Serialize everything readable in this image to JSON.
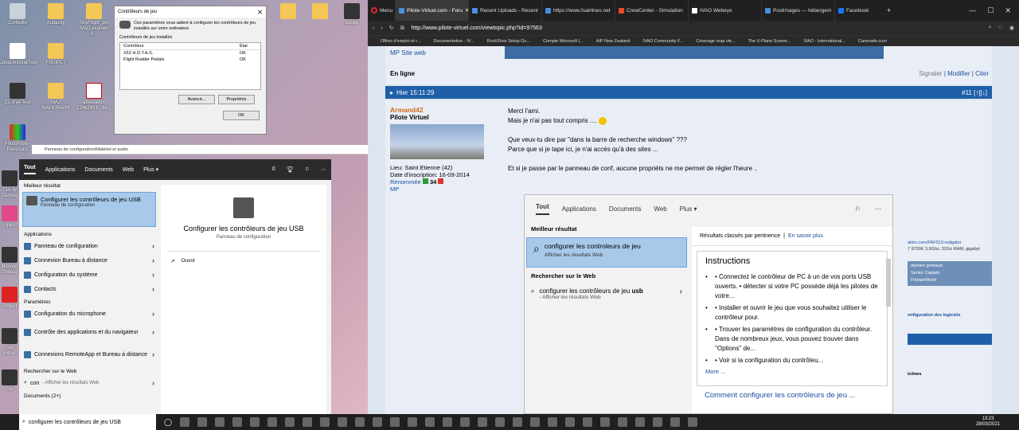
{
  "desktop": {
    "icons": [
      {
        "label": "Corbeille",
        "kind": "bin"
      },
      {
        "label": "Audacity",
        "kind": "folder"
      },
      {
        "label": "TinyFlight_pro IVAO examen S...",
        "kind": "folder"
      },
      {
        "label": "JavaUninstallTool",
        "kind": "java"
      },
      {
        "label": "FSUIPC7",
        "kind": "folder"
      },
      {
        "label": "CL-Eye Test",
        "kind": "dark"
      },
      {
        "label": "MAJ NAVIGRAPH",
        "kind": "folder"
      },
      {
        "label": "attestation 12462431 - de...",
        "kind": "pdf"
      },
      {
        "label": "PhotoFiltre - Raccourci",
        "kind": "photo"
      },
      {
        "label": "T16 W Gaming",
        "kind": "dark"
      },
      {
        "label": "open",
        "kind": "pink"
      },
      {
        "label": "Microso Simula",
        "kind": "dark"
      },
      {
        "label": "Project",
        "kind": "red"
      },
      {
        "label": "Gef Exper",
        "kind": "dark"
      },
      {
        "label": "Ste",
        "kind": "dark"
      }
    ],
    "top_right_icons": [
      {
        "label": "",
        "kind": "folder"
      },
      {
        "label": "",
        "kind": "folder"
      },
      {
        "label": "Loupe",
        "kind": "dark"
      }
    ]
  },
  "joy_dialog": {
    "title": "Contrôleurs de jeu",
    "intro": "Ces paramètres vous aident à configurer les contrôleurs de jeu installés sur votre ordinateur.",
    "group_label": "Contrôleurs de jeu installés",
    "col_controller": "Contrôleur",
    "col_state": "État",
    "rows": [
      {
        "name": "X52 H.O.T.A.S.",
        "state": "OK"
      },
      {
        "name": "Flight Rudder Pedals",
        "state": "OK"
      }
    ],
    "advanced_button": "Avancé...",
    "properties_button": "Propriétés",
    "ok_button": "OK"
  },
  "control_panel_title": "Panneau de configuration\\Matériel et audio",
  "start_search": {
    "tabs": [
      "Tout",
      "Applications",
      "Documents",
      "Web",
      "Plus ▾"
    ],
    "score": "0",
    "best_header": "Meilleur résultat",
    "best_title": "Configurer les contrôleurs de jeu USB",
    "best_sub": "Panneau de configuration",
    "apps_header": "Applications",
    "apps": [
      "Panneau de configuration",
      "Connexion Bureau à distance",
      "Configuration du système",
      "Contacts"
    ],
    "params_header": "Paramètres",
    "params": [
      "Configuration du microphone",
      "Contrôle des applications et du navigateur",
      "Connexions RemoteApp et Bureau à distance"
    ],
    "web_header": "Rechercher sur le Web",
    "web_query": "con",
    "web_sub": "- Afficher les résultats Web",
    "docs_header": "Documents (2+)",
    "right_title": "Configurer les contrôleurs de jeu USB",
    "right_sub": "Panneau de configuration",
    "open_label": "Ouvrir"
  },
  "taskbar": {
    "search_value": "configurer les contrôleurs de jeu USB",
    "time": "13:23",
    "date": "28/03/2021"
  },
  "browser": {
    "menu_label": "Menu",
    "tabs": [
      {
        "label": "Pilote-Virtuel.com - Foru",
        "active": true
      },
      {
        "label": "Recent Uploads - Recent",
        "active": false
      },
      {
        "label": "https://www.fsairlines.net",
        "active": false
      },
      {
        "label": "CrewCenter - Simulation",
        "active": false
      },
      {
        "label": "IVAO Webeye",
        "active": false
      },
      {
        "label": "Postimages — hébergem",
        "active": false
      },
      {
        "label": "Facebook",
        "active": false
      }
    ],
    "url": "http://www.pilote-virtuel.com/viewtopic.php?id=97563",
    "bookmarks": [
      "Offres d'emploi et r...",
      "Documentation - IV...",
      "RockShox Setup Gu...",
      "Compte Microsoft |...",
      "AIP New Zealand",
      "IVAO Community F...",
      "Coverage map vie...",
      "The X-Plane Scener...",
      "IVAO - International...",
      "Carenado.com"
    ]
  },
  "forum": {
    "prev_mp": "MP",
    "prev_site": "Site web",
    "online": "En ligne",
    "actions": [
      "Signaler",
      "Modifier",
      "Citer"
    ],
    "post_time": "Hier 15:11:29",
    "post_num": "#11 [↑][↓]",
    "author_name": "Armand42",
    "author_role": "Pilote Virtuel",
    "author_lieu": "Lieu: Saint Etienne (42)",
    "author_inscription": "Date d'inscription: 16-09-2014",
    "author_renommee_label": "Renommée",
    "author_renommee_value": "34",
    "author_mp": "MP",
    "msg_line1": "Merci l'ami.",
    "msg_line2": "Mais je n'ai pas tout compris ....",
    "msg_line3": "Que veux-tu dire par \"dans la barre de recherche windows\" ???",
    "msg_line4": "Parce que si je tape ici, je n'ai accès qu'à des sites ...",
    "msg_line5": "Et si je passe par le panneau de conf, aucune propriéts ne me permet de régler l'heure ..",
    "side_link": "ation.com/FAF013-ouligator",
    "side_specs": "7 9700K 3,6Ghz, 32Go RAM, gigabyt",
    "side_names": [
      "damien gerbaud",
      "Senior Captain",
      "FlonlairWorld"
    ],
    "side_config": "onfiguration des logiciels",
    "side_icones": "icônes"
  },
  "embed": {
    "tabs": [
      "Tout",
      "Applications",
      "Documents",
      "Web",
      "Plus ▾"
    ],
    "best_header": "Meilleur résultat",
    "best_title": "configurer les controleurs de jeu",
    "best_sub": "Afficher les résultats Web",
    "web_header": "Rechercher sur le Web",
    "web_query_prefix": "configurer les contrôleurs de jeu",
    "web_query_bold": "usb",
    "web_sub": "- Afficher les résultats Web",
    "ranked": "Résultats classés par pertinence",
    "learn_more": "En savoir plus",
    "instructions_title": "Instructions",
    "instructions": [
      "• Connectez le contrôleur de PC à un de vos ports USB ouverts. • détecter si votre PC possède déjà les pilotes de votre...",
      "• Installer et ouvrir le jeu que vous souhaitez utiliser le contrôleur pour.",
      "• Trouver les paramètres de configuration du contrôleur. Dans de nombreux jeux, vous pouvez trouver dans \"Options\" de...",
      "• Voir si la configuration du contrôleu..."
    ],
    "more": "More ...",
    "how_title": "Comment configurer les contrôleurs de jeu ..."
  }
}
